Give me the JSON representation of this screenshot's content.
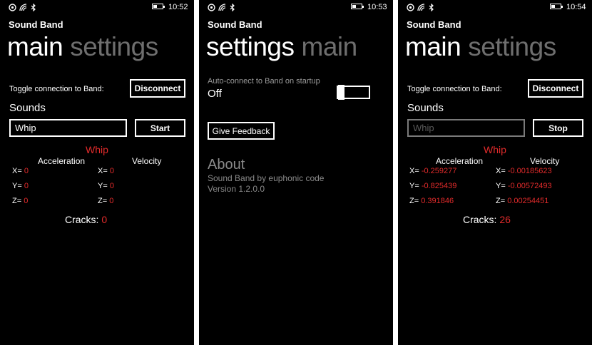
{
  "app_name": "Sound Band",
  "screens": [
    {
      "status": {
        "time": "10:52",
        "battery_level": 0.45
      },
      "pivot": {
        "active": "main",
        "inactive": "settings"
      },
      "toggle_label": "Toggle connection to Band:",
      "connect_button": "Disconnect",
      "sounds_label": "Sounds",
      "sound_value": "Whip",
      "action_button": "Start",
      "sound_title": "Whip",
      "acceleration_header": "Acceleration",
      "velocity_header": "Velocity",
      "accel": [
        {
          "axis": "X=",
          "value": "0"
        },
        {
          "axis": "Y=",
          "value": "0"
        },
        {
          "axis": "Z=",
          "value": "0"
        }
      ],
      "vel": [
        {
          "axis": "X=",
          "value": "0"
        },
        {
          "axis": "Y=",
          "value": "0"
        },
        {
          "axis": "Z=",
          "value": "0"
        }
      ],
      "cracks_label": "Cracks:",
      "cracks_value": "0"
    },
    {
      "status": {
        "time": "10:53",
        "battery_level": 0.45
      },
      "pivot": {
        "active": "settings",
        "inactive": "main"
      },
      "autoconnect_label": "Auto-connect to Band on startup",
      "autoconnect_state": "Off",
      "feedback_button": "Give Feedback",
      "about_title": "About",
      "about_author": "Sound Band by euphonic code",
      "about_version": "Version 1.2.0.0"
    },
    {
      "status": {
        "time": "10:54",
        "battery_level": 0.45
      },
      "pivot": {
        "active": "main",
        "inactive": "settings"
      },
      "toggle_label": "Toggle connection to Band:",
      "connect_button": "Disconnect",
      "sounds_label": "Sounds",
      "sound_value": "Whip",
      "action_button": "Stop",
      "sound_title": "Whip",
      "acceleration_header": "Acceleration",
      "velocity_header": "Velocity",
      "accel": [
        {
          "axis": "X=",
          "value": "-0.259277"
        },
        {
          "axis": "Y=",
          "value": "-0.825439"
        },
        {
          "axis": "Z=",
          "value": "0.391846"
        }
      ],
      "vel": [
        {
          "axis": "X=",
          "value": "-0.00185623"
        },
        {
          "axis": "Y=",
          "value": "-0.00572493"
        },
        {
          "axis": "Z=",
          "value": "0.00254451"
        }
      ],
      "cracks_label": "Cracks:",
      "cracks_value": "26"
    }
  ],
  "icons": [
    "band-icon",
    "wifi-icon",
    "bluetooth-icon",
    "battery-icon"
  ],
  "colors": {
    "accent_red": "#e22b2b",
    "inactive_pivot": "#6e6e6e",
    "background": "#000000"
  }
}
